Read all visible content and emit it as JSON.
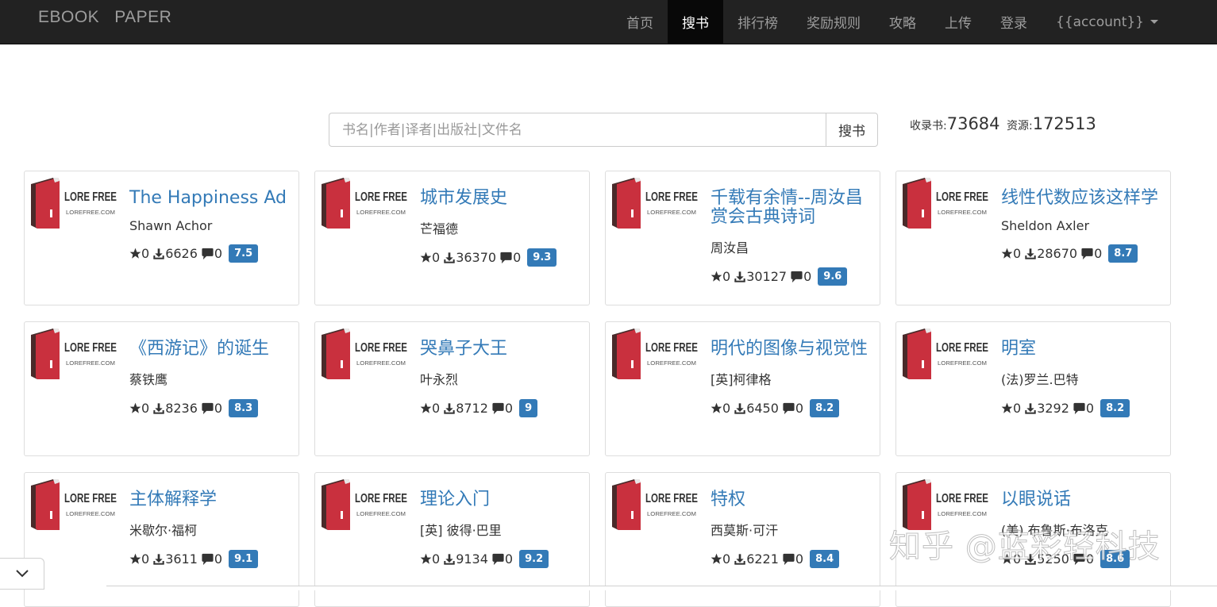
{
  "navbar": {
    "brand": "EBOOK   PAPER",
    "items": [
      {
        "label": "首页",
        "active": false
      },
      {
        "label": "搜书",
        "active": true
      },
      {
        "label": "排行榜",
        "active": false
      },
      {
        "label": "奖励规则",
        "active": false
      },
      {
        "label": "攻略",
        "active": false
      },
      {
        "label": "上传",
        "active": false
      },
      {
        "label": "登录",
        "active": false
      }
    ],
    "account_label": "{{account}}"
  },
  "search": {
    "placeholder": "书名|作者|译者|出版社|文件名",
    "value": "",
    "button_label": "搜书"
  },
  "stats": {
    "books_label": "收录书:",
    "books_count": "73684",
    "resources_label": "资源:",
    "resources_count": "172513"
  },
  "cover": {
    "logo_text": "LORE FREE",
    "logo_sub": "LOREFREE.COM",
    "book_color": "#c9303e",
    "spine_color": "#4a2a2a"
  },
  "books": [
    {
      "title": "The Happiness Ad",
      "author": "Shawn Achor",
      "stars": "0",
      "downloads": "6626",
      "comments": "0",
      "score": "7.5"
    },
    {
      "title": "城市发展史",
      "author": "芒福德",
      "stars": "0",
      "downloads": "36370",
      "comments": "0",
      "score": "9.3"
    },
    {
      "title": "千载有余情--周汝昌赏会古典诗词",
      "author": "周汝昌",
      "stars": "0",
      "downloads": "30127",
      "comments": "0",
      "score": "9.6"
    },
    {
      "title": "线性代数应该这样学",
      "author": "Sheldon Axler",
      "stars": "0",
      "downloads": "28670",
      "comments": "0",
      "score": "8.7"
    },
    {
      "title": "《西游记》的诞生",
      "author": "蔡铁鹰",
      "stars": "0",
      "downloads": "8236",
      "comments": "0",
      "score": "8.3"
    },
    {
      "title": "哭鼻子大王",
      "author": "叶永烈",
      "stars": "0",
      "downloads": "8712",
      "comments": "0",
      "score": "9"
    },
    {
      "title": "明代的图像与视觉性",
      "author": "[英]柯律格",
      "stars": "0",
      "downloads": "6450",
      "comments": "0",
      "score": "8.2"
    },
    {
      "title": "明室",
      "author": "(法)罗兰.巴特",
      "stars": "0",
      "downloads": "3292",
      "comments": "0",
      "score": "8.2"
    },
    {
      "title": "主体解释学",
      "author": "米歇尔·福柯",
      "stars": "0",
      "downloads": "3611",
      "comments": "0",
      "score": "9.1"
    },
    {
      "title": "理论入门",
      "author": "[英] 彼得·巴里",
      "stars": "0",
      "downloads": "9134",
      "comments": "0",
      "score": "9.2"
    },
    {
      "title": "特权",
      "author": "西莫斯·可汗",
      "stars": "0",
      "downloads": "6221",
      "comments": "0",
      "score": "8.4"
    },
    {
      "title": "以眼说话",
      "author": "(美) 布鲁斯·布洛克",
      "stars": "0",
      "downloads": "5250",
      "comments": "0",
      "score": "8.6"
    }
  ],
  "watermark": "知乎 @蓝彩轻科技"
}
